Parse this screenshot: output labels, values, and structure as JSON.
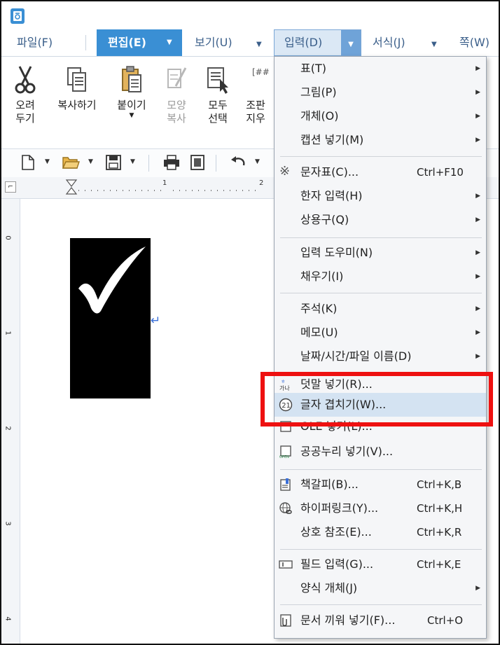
{
  "menubar": {
    "file": "파일(F)",
    "edit": "편집(E)",
    "view": "보기(U)",
    "input": "입력(D)",
    "format": "서식(J)",
    "page": "쪽(W)"
  },
  "ribbon": {
    "cut": "오려\n두기",
    "copy": "복사하기",
    "paste": "붙이기",
    "format_copy": "모양\n복사",
    "select_all": "모두\n선택",
    "layout_clear": "조판\n지우"
  },
  "ruler": {
    "mark1": "1",
    "mark2": "2"
  },
  "vruler": [
    "0",
    "1",
    "2",
    "3",
    "4"
  ],
  "menu_input": {
    "items": [
      {
        "label": "표(T)",
        "submenu": true
      },
      {
        "label": "그림(P)",
        "submenu": true
      },
      {
        "label": "개체(O)",
        "submenu": true
      },
      {
        "label": "캡션 넣기(M)",
        "submenu": true
      },
      {
        "label": "문자표(C)...",
        "shortcut": "Ctrl+F10",
        "icon": "reference-mark-icon"
      },
      {
        "label": "한자 입력(H)",
        "submenu": true
      },
      {
        "label": "상용구(Q)",
        "submenu": true
      },
      {
        "label": "입력 도우미(N)",
        "submenu": true
      },
      {
        "label": "채우기(I)",
        "submenu": true
      },
      {
        "label": "주석(K)",
        "submenu": true
      },
      {
        "label": "메모(U)",
        "submenu": true
      },
      {
        "label": "날짜/시간/파일 이름(D)",
        "submenu": true
      },
      {
        "label": "덧말 넣기(R)...",
        "icon": "ruby-text-icon"
      },
      {
        "label": "글자 겹치기(W)...",
        "icon": "circled-number-icon",
        "highlighted": true
      },
      {
        "label": "OLE 넣기(L)...",
        "icon": "ole-object-icon"
      },
      {
        "label": "공공누리 넣기(V)...",
        "icon": "open-license-icon"
      },
      {
        "label": "책갈피(B)...",
        "shortcut": "Ctrl+K,B",
        "icon": "bookmark-icon"
      },
      {
        "label": "하이퍼링크(Y)...",
        "shortcut": "Ctrl+K,H",
        "icon": "hyperlink-icon"
      },
      {
        "label": "상호 참조(E)...",
        "shortcut": "Ctrl+K,R"
      },
      {
        "label": "필드 입력(G)...",
        "shortcut": "Ctrl+K,E",
        "icon": "field-icon"
      },
      {
        "label": "양식 개체(J)",
        "submenu": true
      },
      {
        "label": "문서 끼워 넣기(F)...",
        "shortcut": "Ctrl+O",
        "icon": "insert-document-icon"
      }
    ]
  },
  "colors": {
    "accent": "#3a8fd4",
    "highlight": "#d4e3f2",
    "annotation": "#ee1111"
  }
}
